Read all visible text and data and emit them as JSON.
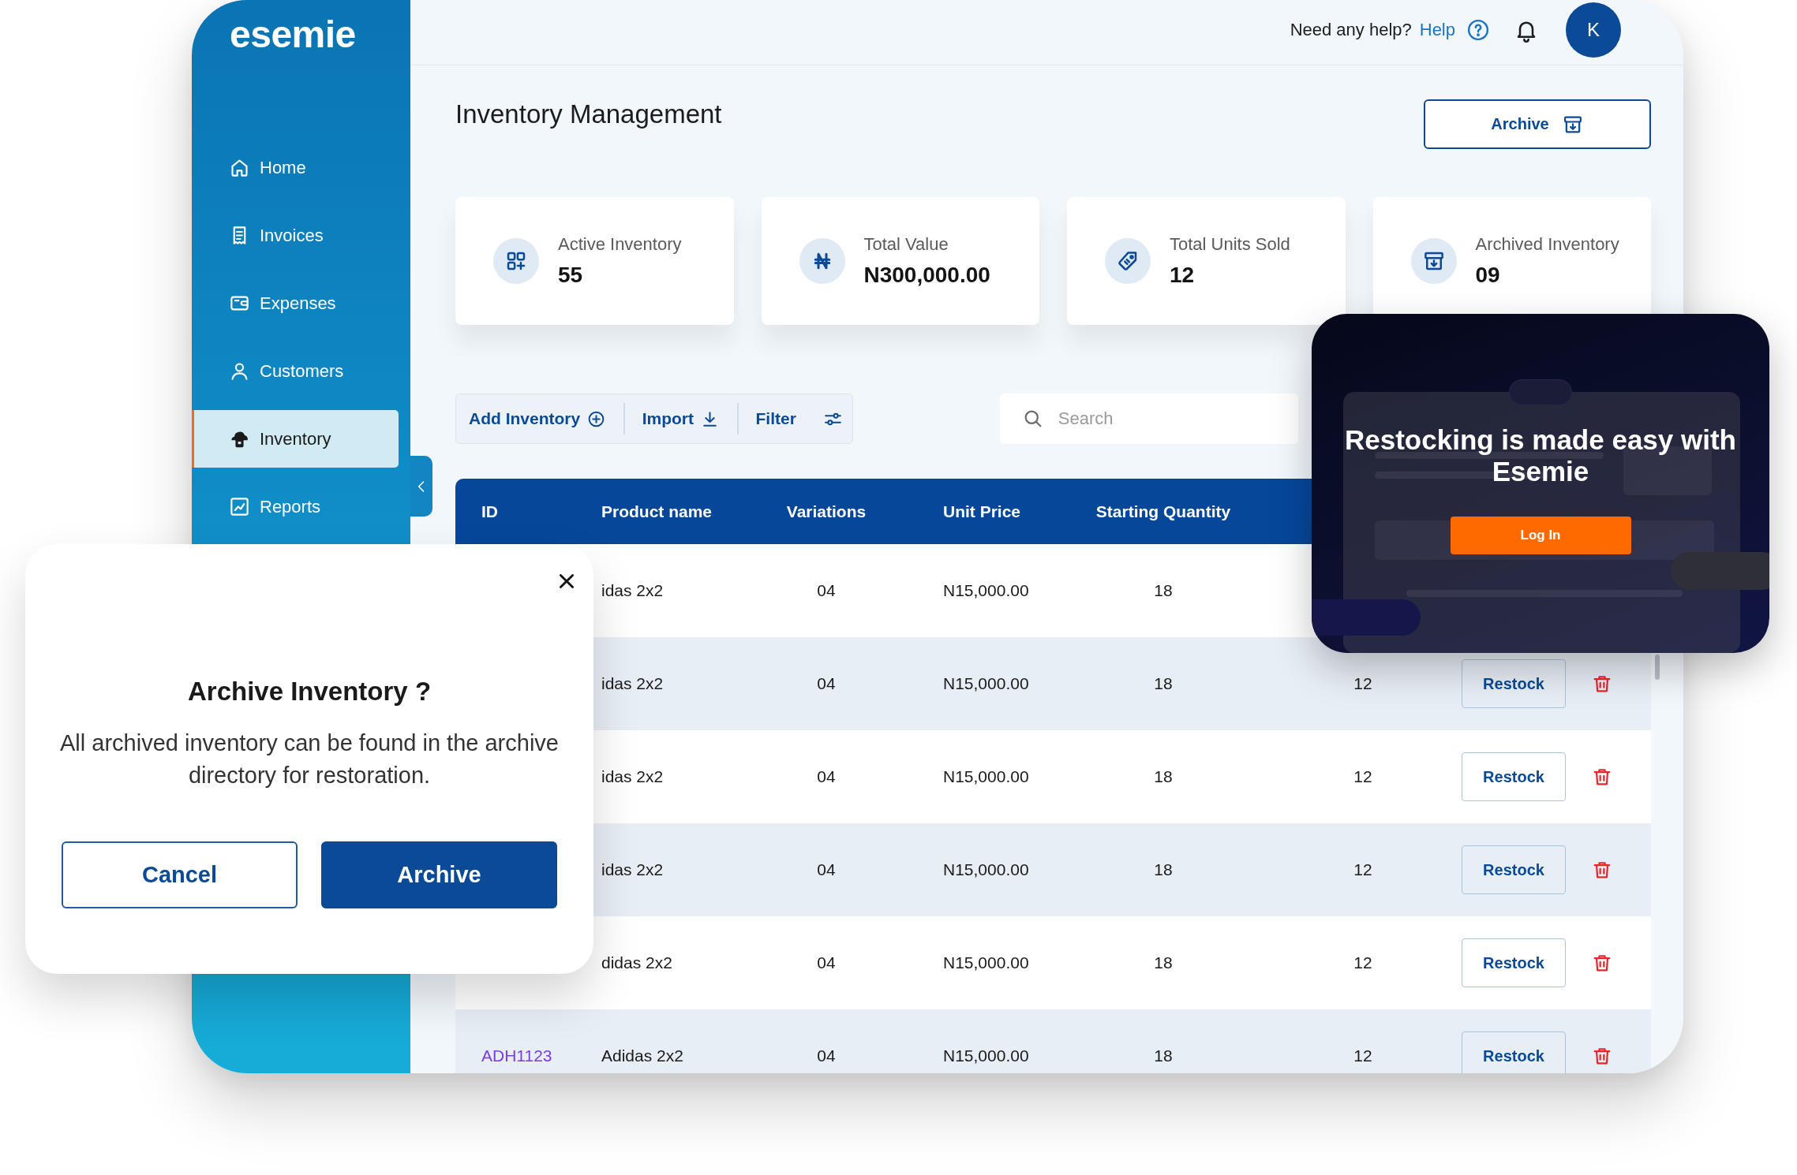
{
  "logo": "esemie",
  "sidebar": {
    "items": [
      {
        "label": "Home",
        "kind": "home",
        "selected": false
      },
      {
        "label": "Invoices",
        "kind": "invoices",
        "selected": false
      },
      {
        "label": "Expenses",
        "kind": "expenses",
        "selected": false
      },
      {
        "label": "Customers",
        "kind": "customers",
        "selected": false
      },
      {
        "label": "Inventory",
        "kind": "inventory",
        "selected": true
      },
      {
        "label": "Reports",
        "kind": "reports",
        "selected": false
      }
    ]
  },
  "header": {
    "help_prompt": "Need any help?",
    "help_link": "Help",
    "avatar_initial": "K"
  },
  "page": {
    "title": "Inventory Management",
    "archive_button": "Archive"
  },
  "stats": [
    {
      "label": "Active Inventory",
      "value": "55",
      "kind": "grid"
    },
    {
      "label": "Total Value",
      "value": "N300,000.00",
      "kind": "naira"
    },
    {
      "label": "Total Units Sold",
      "value": "12",
      "kind": "tag"
    },
    {
      "label": "Archived Inventory",
      "value": "09",
      "kind": "archive"
    }
  ],
  "toolbar": {
    "actions": [
      {
        "label": "Add Inventory",
        "kind": "add"
      },
      {
        "label": "Import",
        "kind": "import"
      },
      {
        "label": "Filter",
        "kind": "filter"
      }
    ],
    "search": {
      "placeholder": "Search"
    }
  },
  "table": {
    "columns": [
      "ID",
      "Product name",
      "Variations",
      "Unit Price",
      "Starting Quantity"
    ],
    "rows": [
      {
        "product_name": "idas 2x2",
        "variations": "04",
        "unit_price": "N15,000.00",
        "starting_quantity": "18"
      },
      {
        "product_name": "idas 2x2",
        "variations": "04",
        "unit_price": "N15,000.00",
        "starting_quantity": "18",
        "column_6": "12",
        "action": "Restock"
      },
      {
        "product_name": "idas 2x2",
        "variations": "04",
        "unit_price": "N15,000.00",
        "starting_quantity": "18",
        "column_6": "12",
        "action": "Restock"
      },
      {
        "product_name": "idas 2x2",
        "variations": "04",
        "unit_price": "N15,000.00",
        "starting_quantity": "18",
        "column_6": "12",
        "action": "Restock"
      },
      {
        "product_name": "didas 2x2",
        "variations": "04",
        "unit_price": "N15,000.00",
        "starting_quantity": "18",
        "column_6": "12",
        "action": "Restock"
      },
      {
        "id": "ADH1123",
        "product_name": "Adidas 2x2",
        "variations": "04",
        "unit_price": "N15,000.00",
        "starting_quantity": "18",
        "column_6": "12",
        "action": "Restock"
      }
    ]
  },
  "dialog": {
    "title": "Archive Inventory ?",
    "message": "All archived inventory can be found in the archive directory for restoration.",
    "buttons": [
      {
        "label": "Cancel",
        "kind": "secondary"
      },
      {
        "label": "Archive",
        "kind": "primary"
      }
    ]
  },
  "promo": {
    "heading": "Restocking is made easy with Esemie",
    "button": "Log In"
  }
}
